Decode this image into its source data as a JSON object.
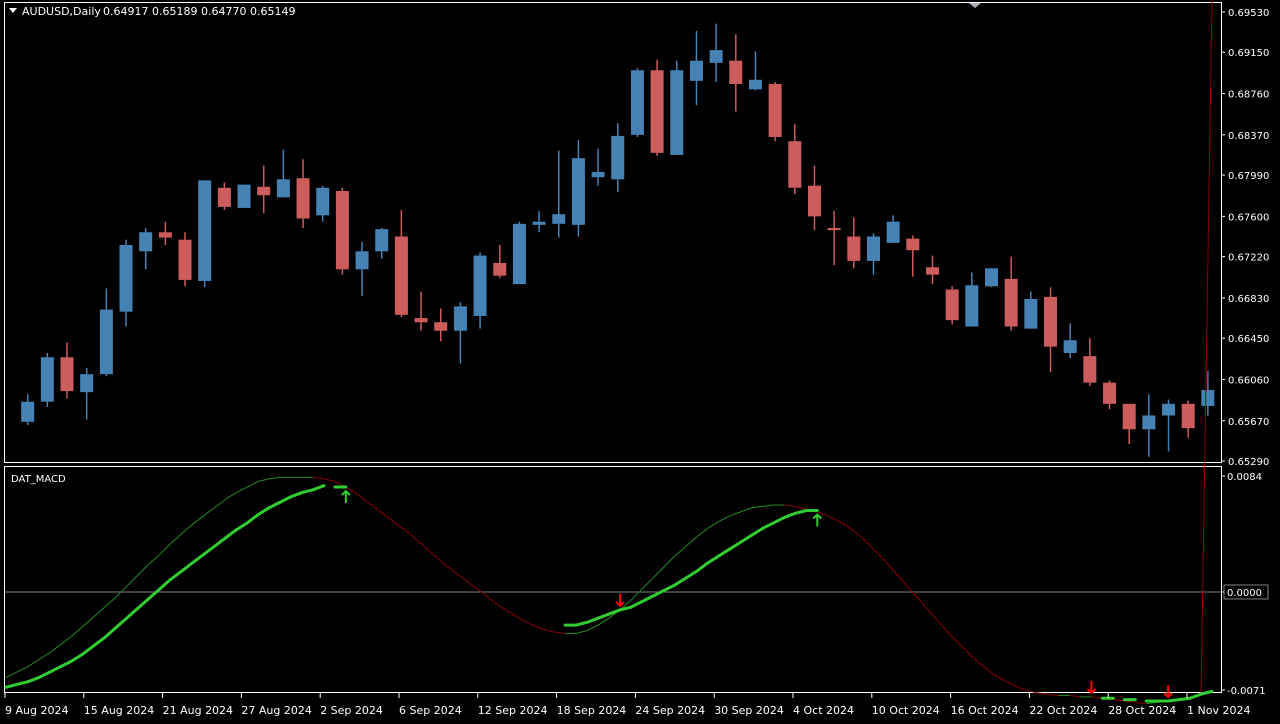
{
  "colors": {
    "background": "#000000",
    "frame": "#ffffff",
    "text": "#ffffff",
    "bull_candle": "#4682b4",
    "bear_candle": "#cd5c5c",
    "macd_line": "#32cd32",
    "signal_up": "#228b22",
    "signal_down": "#8b0000",
    "zero_line": "#808080",
    "arrow_up": "#32cd32",
    "arrow_down": "#ff0000"
  },
  "header": {
    "symbol_label": "AUDUSD,Daily",
    "ohlc_label": "0.64917 0.65189 0.64770 0.65149",
    "indicator_label": "DAT_MACD"
  },
  "chart_data": [
    {
      "type": "candlestick",
      "symbol": "AUDUSD",
      "timeframe": "Daily",
      "ylim": [
        0.6529,
        0.6953
      ],
      "y_ticks": [
        "0.69530",
        "0.69150",
        "0.68760",
        "0.68370",
        "0.67990",
        "0.67600",
        "0.67220",
        "0.66830",
        "0.66450",
        "0.66060",
        "0.65670",
        "0.65290"
      ],
      "x_ticks": [
        "9 Aug 2024",
        "15 Aug 2024",
        "21 Aug 2024",
        "27 Aug 2024",
        "2 Sep 2024",
        "6 Sep 2024",
        "12 Sep 2024",
        "18 Sep 2024",
        "24 Sep 2024",
        "30 Sep 2024",
        "4 Oct 2024",
        "10 Oct 2024",
        "16 Oct 2024",
        "22 Oct 2024",
        "28 Oct 2024",
        "1 Nov 2024"
      ],
      "candles": [
        {
          "o": 0.6585,
          "h": 0.6601,
          "l": 0.6565,
          "c": 0.657
        },
        {
          "o": 0.6566,
          "h": 0.6592,
          "l": 0.6563,
          "c": 0.6585
        },
        {
          "o": 0.6585,
          "h": 0.6631,
          "l": 0.658,
          "c": 0.6627
        },
        {
          "o": 0.6627,
          "h": 0.6641,
          "l": 0.6588,
          "c": 0.6595
        },
        {
          "o": 0.6594,
          "h": 0.6617,
          "l": 0.6568,
          "c": 0.6611
        },
        {
          "o": 0.6611,
          "h": 0.6692,
          "l": 0.6609,
          "c": 0.6672
        },
        {
          "o": 0.667,
          "h": 0.6738,
          "l": 0.6656,
          "c": 0.6733
        },
        {
          "o": 0.6727,
          "h": 0.6749,
          "l": 0.671,
          "c": 0.6745
        },
        {
          "o": 0.6745,
          "h": 0.6755,
          "l": 0.6733,
          "c": 0.674
        },
        {
          "o": 0.6738,
          "h": 0.6745,
          "l": 0.6694,
          "c": 0.67
        },
        {
          "o": 0.6699,
          "h": 0.6794,
          "l": 0.6693,
          "c": 0.6794
        },
        {
          "o": 0.6787,
          "h": 0.6792,
          "l": 0.6766,
          "c": 0.6769
        },
        {
          "o": 0.6768,
          "h": 0.679,
          "l": 0.6768,
          "c": 0.679
        },
        {
          "o": 0.6788,
          "h": 0.6808,
          "l": 0.6763,
          "c": 0.678
        },
        {
          "o": 0.6778,
          "h": 0.6823,
          "l": 0.6778,
          "c": 0.6795
        },
        {
          "o": 0.6796,
          "h": 0.6814,
          "l": 0.6749,
          "c": 0.6758
        },
        {
          "o": 0.6761,
          "h": 0.6789,
          "l": 0.6755,
          "c": 0.6787
        },
        {
          "o": 0.6784,
          "h": 0.6787,
          "l": 0.6705,
          "c": 0.671
        },
        {
          "o": 0.671,
          "h": 0.6736,
          "l": 0.6685,
          "c": 0.6727
        },
        {
          "o": 0.6727,
          "h": 0.6749,
          "l": 0.672,
          "c": 0.6748
        },
        {
          "o": 0.6741,
          "h": 0.6766,
          "l": 0.6665,
          "c": 0.6667
        },
        {
          "o": 0.6664,
          "h": 0.6689,
          "l": 0.6652,
          "c": 0.666
        },
        {
          "o": 0.666,
          "h": 0.6673,
          "l": 0.6642,
          "c": 0.6652
        },
        {
          "o": 0.6652,
          "h": 0.6679,
          "l": 0.6621,
          "c": 0.6675
        },
        {
          "o": 0.6666,
          "h": 0.6726,
          "l": 0.6654,
          "c": 0.6723
        },
        {
          "o": 0.6716,
          "h": 0.6733,
          "l": 0.6702,
          "c": 0.6704
        },
        {
          "o": 0.6696,
          "h": 0.6755,
          "l": 0.6696,
          "c": 0.6753
        },
        {
          "o": 0.6752,
          "h": 0.6765,
          "l": 0.6745,
          "c": 0.6755
        },
        {
          "o": 0.6753,
          "h": 0.6822,
          "l": 0.674,
          "c": 0.6762
        },
        {
          "o": 0.6752,
          "h": 0.6832,
          "l": 0.6741,
          "c": 0.6815
        },
        {
          "o": 0.6797,
          "h": 0.6824,
          "l": 0.6789,
          "c": 0.6802
        },
        {
          "o": 0.6795,
          "h": 0.6848,
          "l": 0.6783,
          "c": 0.6836
        },
        {
          "o": 0.6837,
          "h": 0.69,
          "l": 0.6835,
          "c": 0.6898
        },
        {
          "o": 0.6898,
          "h": 0.6908,
          "l": 0.6817,
          "c": 0.682
        },
        {
          "o": 0.6818,
          "h": 0.6907,
          "l": 0.6818,
          "c": 0.6898
        },
        {
          "o": 0.6888,
          "h": 0.6935,
          "l": 0.6865,
          "c": 0.6907
        },
        {
          "o": 0.6905,
          "h": 0.6942,
          "l": 0.6887,
          "c": 0.6917
        },
        {
          "o": 0.6907,
          "h": 0.6932,
          "l": 0.6859,
          "c": 0.6885
        },
        {
          "o": 0.688,
          "h": 0.6916,
          "l": 0.6879,
          "c": 0.6889
        },
        {
          "o": 0.6885,
          "h": 0.6887,
          "l": 0.6831,
          "c": 0.6835
        },
        {
          "o": 0.6831,
          "h": 0.6847,
          "l": 0.6781,
          "c": 0.6787
        },
        {
          "o": 0.6789,
          "h": 0.6808,
          "l": 0.6747,
          "c": 0.676
        },
        {
          "o": 0.6749,
          "h": 0.6765,
          "l": 0.6714,
          "c": 0.6747
        },
        {
          "o": 0.6741,
          "h": 0.6759,
          "l": 0.6711,
          "c": 0.6718
        },
        {
          "o": 0.6718,
          "h": 0.6744,
          "l": 0.6705,
          "c": 0.6741
        },
        {
          "o": 0.6735,
          "h": 0.6761,
          "l": 0.6735,
          "c": 0.6755
        },
        {
          "o": 0.6739,
          "h": 0.6742,
          "l": 0.6703,
          "c": 0.6728
        },
        {
          "o": 0.6712,
          "h": 0.6723,
          "l": 0.6696,
          "c": 0.6705
        },
        {
          "o": 0.6691,
          "h": 0.6694,
          "l": 0.6658,
          "c": 0.6662
        },
        {
          "o": 0.6656,
          "h": 0.6707,
          "l": 0.6656,
          "c": 0.6695
        },
        {
          "o": 0.6694,
          "h": 0.6711,
          "l": 0.6693,
          "c": 0.6711
        },
        {
          "o": 0.6701,
          "h": 0.6722,
          "l": 0.6652,
          "c": 0.6656
        },
        {
          "o": 0.6654,
          "h": 0.6689,
          "l": 0.6654,
          "c": 0.6682
        },
        {
          "o": 0.6684,
          "h": 0.6693,
          "l": 0.6613,
          "c": 0.6637
        },
        {
          "o": 0.6631,
          "h": 0.6659,
          "l": 0.6626,
          "c": 0.6643
        },
        {
          "o": 0.6628,
          "h": 0.6645,
          "l": 0.66,
          "c": 0.6603
        },
        {
          "o": 0.6603,
          "h": 0.6605,
          "l": 0.6578,
          "c": 0.6583
        },
        {
          "o": 0.6583,
          "h": 0.6583,
          "l": 0.6545,
          "c": 0.6559
        },
        {
          "o": 0.6559,
          "h": 0.6592,
          "l": 0.6533,
          "c": 0.6572
        },
        {
          "o": 0.6572,
          "h": 0.6587,
          "l": 0.6538,
          "c": 0.6583
        },
        {
          "o": 0.6583,
          "h": 0.6586,
          "l": 0.6551,
          "c": 0.656
        },
        {
          "o": 0.6581,
          "h": 0.6614,
          "l": 0.6572,
          "c": 0.6596
        }
      ]
    },
    {
      "type": "line",
      "name": "DAT_MACD",
      "ylim": [
        -0.0071,
        0.0084
      ],
      "y_ticks": [
        "0.0084",
        "0.0000",
        "-0.0071"
      ],
      "zero_label": "0.0000",
      "macd": [
        -0.0069,
        -0.0067,
        -0.0065,
        -0.0062,
        -0.0058,
        -0.0054,
        -0.005,
        -0.0045,
        -0.0039,
        -0.0033,
        -0.0026,
        -0.0019,
        -0.0012,
        -0.0005,
        0.0002,
        0.0009,
        0.0015,
        0.0021,
        0.0027,
        0.0033,
        0.0039,
        0.0045,
        0.005,
        0.0056,
        0.0061,
        0.0065,
        0.0069,
        0.0072,
        0.0074,
        0.0077,
        0.0076,
        0.0076,
        0.0075,
        0.0074,
        0.0072,
        0.0069,
        0.0064,
        0.0058,
        0.0052,
        0.0044,
        0.0036,
        0.0028,
        0.002,
        0.0012,
        0.0005,
        -0.0002,
        -0.0008,
        -0.0013,
        -0.0017,
        -0.002,
        -0.0022,
        -0.0024,
        -0.0024,
        -0.0022,
        -0.0019,
        -0.0016,
        -0.0013,
        -0.0011,
        -0.0007,
        -0.0003,
        0.0001,
        0.0005,
        0.001,
        0.0015,
        0.0021,
        0.0026,
        0.0031,
        0.0036,
        0.0041,
        0.0046,
        0.005,
        0.0054,
        0.0057,
        0.0059,
        0.0059,
        0.0058,
        0.0056,
        0.0053,
        0.0048,
        0.0042,
        0.0035,
        0.0026,
        0.0017,
        0.0006,
        -0.0003,
        -0.0011,
        -0.0019,
        -0.0026,
        -0.0033,
        -0.004,
        -0.0046,
        -0.0052,
        -0.0057,
        -0.0062,
        -0.0066,
        -0.0069,
        -0.0072,
        -0.0074,
        -0.0075,
        -0.0076,
        -0.0077,
        -0.0077,
        -0.0078,
        -0.0078,
        -0.0079,
        -0.0079,
        -0.0079,
        -0.0078,
        -0.0077,
        -0.0074,
        -0.0072
      ],
      "signal": [
        -0.0062,
        -0.0058,
        -0.0054,
        -0.0049,
        -0.0044,
        -0.0038,
        -0.0032,
        -0.0025,
        -0.0018,
        -0.0011,
        -0.0004,
        0.0004,
        0.0012,
        0.002,
        0.0027,
        0.0035,
        0.0042,
        0.0049,
        0.0055,
        0.0061,
        0.0067,
        0.0072,
        0.0076,
        0.008,
        0.0082,
        0.0083,
        0.0083,
        0.0083,
        0.0083,
        0.0082,
        0.008,
        0.0076,
        0.0071,
        0.0065,
        0.0059,
        0.0053,
        0.0047,
        0.0041,
        0.0034,
        0.0027,
        0.002,
        0.0014,
        0.0008,
        0.0002,
        -0.0004,
        -0.001,
        -0.0015,
        -0.002,
        -0.0024,
        -0.0027,
        -0.0029,
        -0.003,
        -0.003,
        -0.0028,
        -0.0024,
        -0.0019,
        -0.0013,
        -0.0006,
        0.0002,
        0.001,
        0.0018,
        0.0026,
        0.0033,
        0.004,
        0.0046,
        0.0051,
        0.0055,
        0.0058,
        0.0061,
        0.0062,
        0.0063,
        0.0063,
        0.0062,
        0.006,
        0.0058,
        0.0055,
        0.0051,
        0.0046,
        0.004,
        0.0032,
        0.0024,
        0.0015,
        0.0006,
        -0.0003,
        -0.0012,
        -0.0021,
        -0.003,
        -0.0038,
        -0.0046,
        -0.0053,
        -0.0059,
        -0.0064,
        -0.0068,
        -0.0071,
        -0.0073,
        -0.0074,
        -0.0075,
        -0.0075,
        -0.0076,
        -0.0076,
        -0.0077,
        -0.0078,
        -0.0079,
        -0.008,
        -0.0081,
        -0.008,
        -0.0079,
        -0.0078,
        -0.0077,
        -0.0075
      ]
    }
  ]
}
